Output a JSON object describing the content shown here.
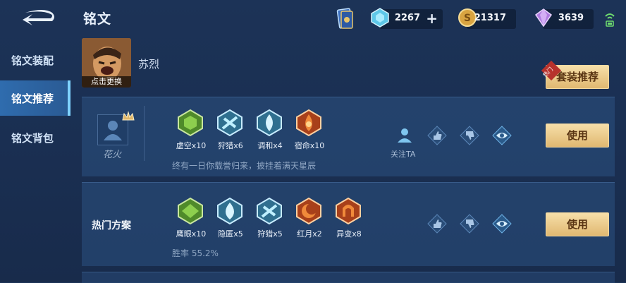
{
  "header": {
    "title": "铭文",
    "back_icon": "back-arrow-icon",
    "currencies": {
      "coupon": {
        "icon": "diamond-coupon-icon",
        "value": "2267"
      },
      "gold": {
        "icon": "gold-coin-icon",
        "value": "21317"
      },
      "gem": {
        "icon": "purple-gem-icon",
        "value": "3639"
      }
    },
    "plus_label": "+"
  },
  "sidebar": {
    "items": [
      {
        "label": "铭文装配",
        "active": false
      },
      {
        "label": "铭文推荐",
        "active": true
      },
      {
        "label": "铭文背包",
        "active": false
      }
    ]
  },
  "hero": {
    "name": "苏烈",
    "change_label": "点击更换"
  },
  "suit_button": {
    "label": "套装推荐",
    "tag": "热门"
  },
  "plans": [
    {
      "author": "花火",
      "runes": [
        {
          "name": "虚空",
          "count": "x10",
          "color": "green"
        },
        {
          "name": "狩猎",
          "count": "x6",
          "color": "blue"
        },
        {
          "name": "调和",
          "count": "x4",
          "color": "blue"
        },
        {
          "name": "宿命",
          "count": "x10",
          "color": "red"
        }
      ],
      "description": "终有一日你载誉归来，披挂着满天星辰",
      "follow_label": "关注TA",
      "use_label": "使用"
    },
    {
      "title": "热门方案",
      "runes": [
        {
          "name": "鹰眼",
          "count": "x10",
          "color": "green"
        },
        {
          "name": "隐匿",
          "count": "x5",
          "color": "blue"
        },
        {
          "name": "狩猎",
          "count": "x5",
          "color": "blue"
        },
        {
          "name": "红月",
          "count": "x2",
          "color": "red"
        },
        {
          "name": "异变",
          "count": "x8",
          "color": "red"
        }
      ],
      "description": "胜率 55.2%",
      "use_label": "使用"
    }
  ],
  "colors": {
    "green_rune": "#6aa83a",
    "blue_rune": "#5fb6d4",
    "red_rune": "#d45a22",
    "gold_button": "#e9c887",
    "active_tab": "#2f6cae"
  }
}
